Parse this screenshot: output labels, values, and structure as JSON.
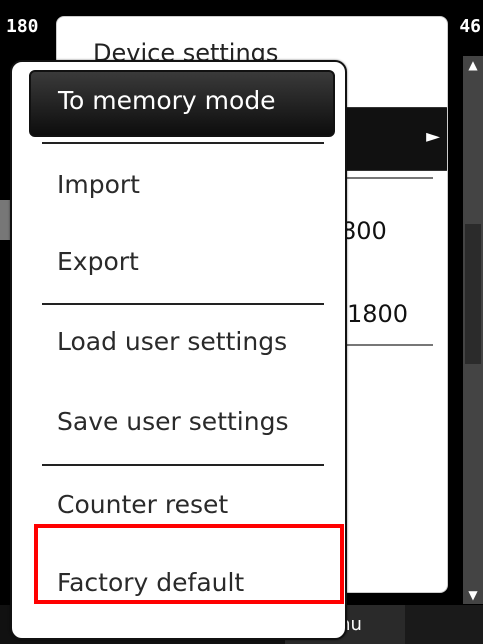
{
  "statusbar": {
    "left": "180",
    "center": "",
    "right": "46"
  },
  "back_window": {
    "title": "Device settings",
    "values": [
      "800",
      "1800"
    ]
  },
  "menu": {
    "items": [
      {
        "label": "To memory mode",
        "active": true
      },
      {
        "label": "Import",
        "active": false
      },
      {
        "label": "Export",
        "active": false
      },
      {
        "label": "Load user settings",
        "active": false
      },
      {
        "label": "Save user settings",
        "active": false
      },
      {
        "label": "Counter reset",
        "active": false,
        "highlighted": true
      },
      {
        "label": "Factory default",
        "active": false
      }
    ]
  },
  "bottom_bar": {
    "right_label": "enu"
  },
  "colors": {
    "highlight": "#ff0000",
    "active_bg": "#111111",
    "menu_bg": "#ffffff",
    "screen_bg": "#000000"
  }
}
